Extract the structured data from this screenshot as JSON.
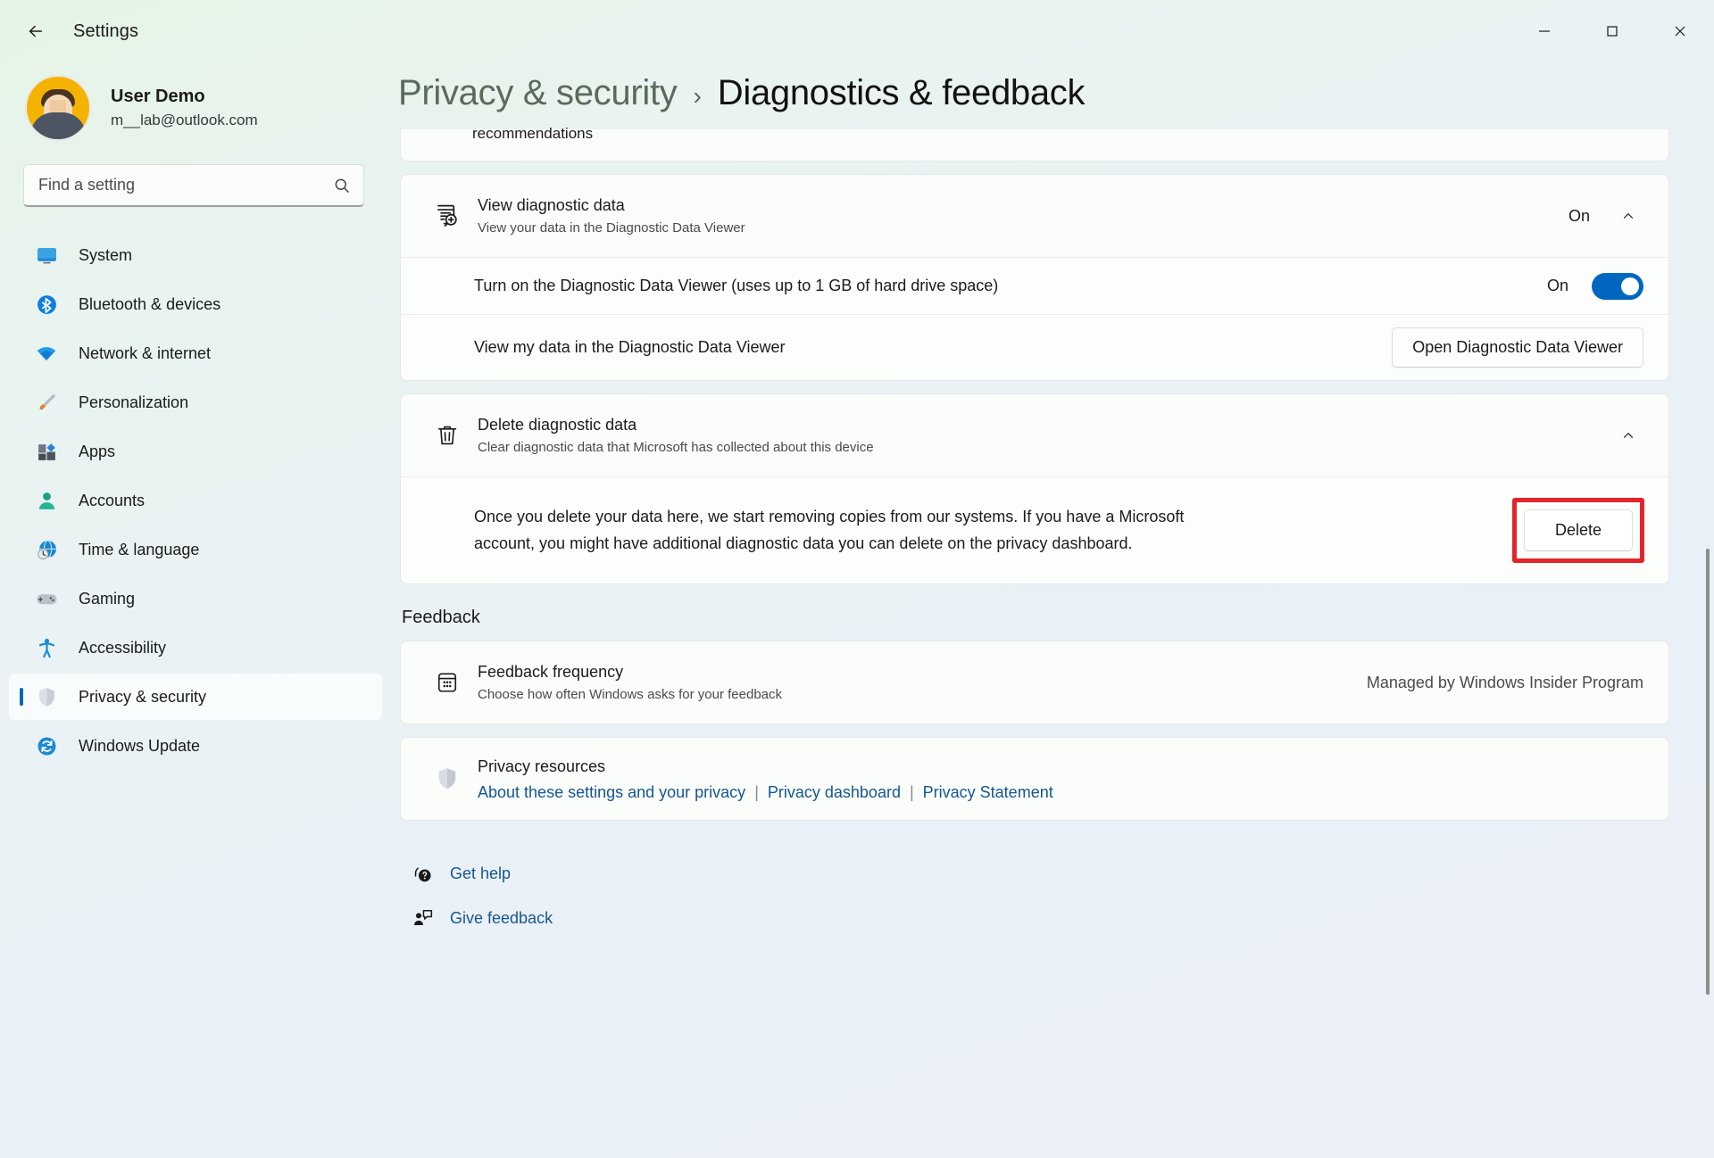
{
  "window": {
    "title": "Settings",
    "back_icon": "back-arrow-icon",
    "minimize_label": "Minimize",
    "maximize_label": "Maximize",
    "close_label": "Close"
  },
  "profile": {
    "name": "User Demo",
    "email": "m__lab@outlook.com"
  },
  "search": {
    "placeholder": "Find a setting",
    "value": "",
    "icon": "search-icon"
  },
  "sidebar": {
    "items": [
      {
        "label": "System",
        "icon": "monitor-icon",
        "active": false
      },
      {
        "label": "Bluetooth & devices",
        "icon": "bluetooth-icon",
        "active": false
      },
      {
        "label": "Network & internet",
        "icon": "wifi-icon",
        "active": false
      },
      {
        "label": "Personalization",
        "icon": "paintbrush-icon",
        "active": false
      },
      {
        "label": "Apps",
        "icon": "apps-icon",
        "active": false
      },
      {
        "label": "Accounts",
        "icon": "person-icon",
        "active": false
      },
      {
        "label": "Time & language",
        "icon": "clock-globe-icon",
        "active": false
      },
      {
        "label": "Gaming",
        "icon": "gamepad-icon",
        "active": false
      },
      {
        "label": "Accessibility",
        "icon": "accessibility-icon",
        "active": false
      },
      {
        "label": "Privacy & security",
        "icon": "shield-icon",
        "active": true
      },
      {
        "label": "Windows Update",
        "icon": "update-icon",
        "active": false
      }
    ]
  },
  "breadcrumb": {
    "parent": "Privacy & security",
    "separator": "›",
    "current": "Diagnostics & feedback"
  },
  "main": {
    "clipped_card_text": "recommendations",
    "view_diagnostic": {
      "title": "View diagnostic data",
      "subtitle": "View your data in the Diagnostic Data Viewer",
      "state": "On",
      "icon": "document-search-icon",
      "chevron": "chevron-up-icon",
      "sub_rows": [
        {
          "label": "Turn on the Diagnostic Data Viewer (uses up to 1 GB of hard drive space)",
          "control": "toggle",
          "state": "On"
        },
        {
          "label": "View my data in the Diagnostic Data Viewer",
          "control": "button",
          "button_label": "Open Diagnostic Data Viewer"
        }
      ]
    },
    "delete_diagnostic": {
      "title": "Delete diagnostic data",
      "subtitle": "Clear diagnostic data that Microsoft has collected about this device",
      "icon": "trash-icon",
      "chevron": "chevron-up-icon",
      "paragraph": "Once you delete your data here, we start removing copies from our systems. If you have a Microsoft account, you might have additional diagnostic data you can delete on the privacy dashboard.",
      "button_label": "Delete",
      "highlight_color": "#e3242b"
    },
    "feedback_section_title": "Feedback",
    "feedback_frequency": {
      "title": "Feedback frequency",
      "subtitle": "Choose how often Windows asks for your feedback",
      "status": "Managed by Windows Insider Program",
      "icon": "calendar-frequency-icon"
    },
    "privacy_resources": {
      "title": "Privacy resources",
      "icon": "shield-icon",
      "links": [
        "About these settings and your privacy",
        "Privacy dashboard",
        "Privacy Statement"
      ],
      "separator": "|"
    },
    "footer_links": [
      {
        "label": "Get help",
        "icon": "help-question-icon"
      },
      {
        "label": "Give feedback",
        "icon": "feedback-person-icon"
      }
    ]
  },
  "colors": {
    "accent": "#0067c0",
    "link": "#15568f",
    "highlight_red": "#e3242b"
  }
}
